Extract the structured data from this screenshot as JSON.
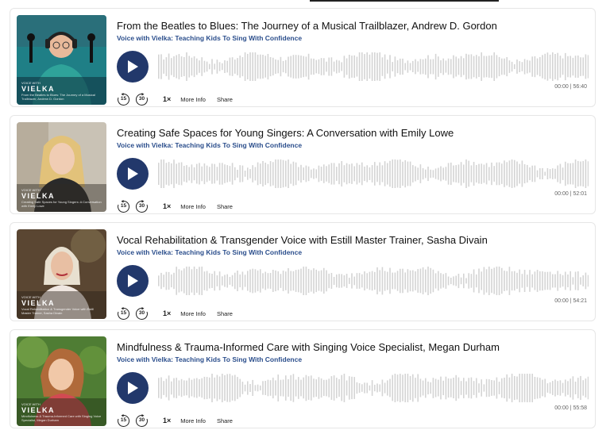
{
  "show_name": "Voice with Vielka: Teaching Kids To Sing With Confidence",
  "colors": {
    "accent": "#22386b",
    "show_link": "#2b4e8c",
    "waveform": "#d4d4d4"
  },
  "controls": {
    "skip_back": "15",
    "skip_forward": "30",
    "speed": "1×",
    "more_info": "More Info",
    "share": "Share"
  },
  "episodes": [
    {
      "title": "From the Beatles to Blues: The Journey of a Musical Trailblazer, Andrew D. Gordon",
      "show": "Voice with Vielka: Teaching Kids To Sing With Confidence",
      "current": "00:00",
      "duration": "56:40",
      "progress": 0,
      "art": {
        "brand": "VIELKA",
        "small": "VOICE WITH",
        "episode_text": "From the Beatles to Blues: The Journey of a Musical Trailblazer, Andrew D. Gordon",
        "bg": "#1f7f86"
      }
    },
    {
      "title": "Creating Safe Spaces for Young Singers: A Conversation with Emily Lowe",
      "show": "Voice with Vielka: Teaching Kids To Sing With Confidence",
      "current": "00:00",
      "duration": "52:01",
      "progress": 0,
      "art": {
        "brand": "VIELKA",
        "small": "VOICE WITH",
        "episode_text": "Creating Safe Spaces for Young Singers: A Conversation with Emily Lowe",
        "bg": "#8a8070"
      }
    },
    {
      "title": "Vocal Rehabilitation & Transgender Voice with Estill Master Trainer, Sasha Divain",
      "show": "Voice with Vielka: Teaching Kids To Sing With Confidence",
      "current": "00:00",
      "duration": "54:21",
      "progress": 0,
      "art": {
        "brand": "VIELKA",
        "small": "VOICE WITH",
        "episode_text": "Vocal Rehabilitation & Transgender Voice with Estill Master Trainer, Sasha Divain",
        "bg": "#4a3b2c"
      }
    },
    {
      "title": "Mindfulness & Trauma-Informed Care with Singing Voice Specialist, Megan Durham",
      "show": "Voice with Vielka: Teaching Kids To Sing With Confidence",
      "current": "00:00",
      "duration": "55:58",
      "progress": 0,
      "art": {
        "brand": "VIELKA",
        "small": "VOICE WITH",
        "episode_text": "Mindfulness & Trauma-Informed Care with Singing Voice Specialist, Megan Durham",
        "bg": "#3f6b2a"
      }
    }
  ]
}
